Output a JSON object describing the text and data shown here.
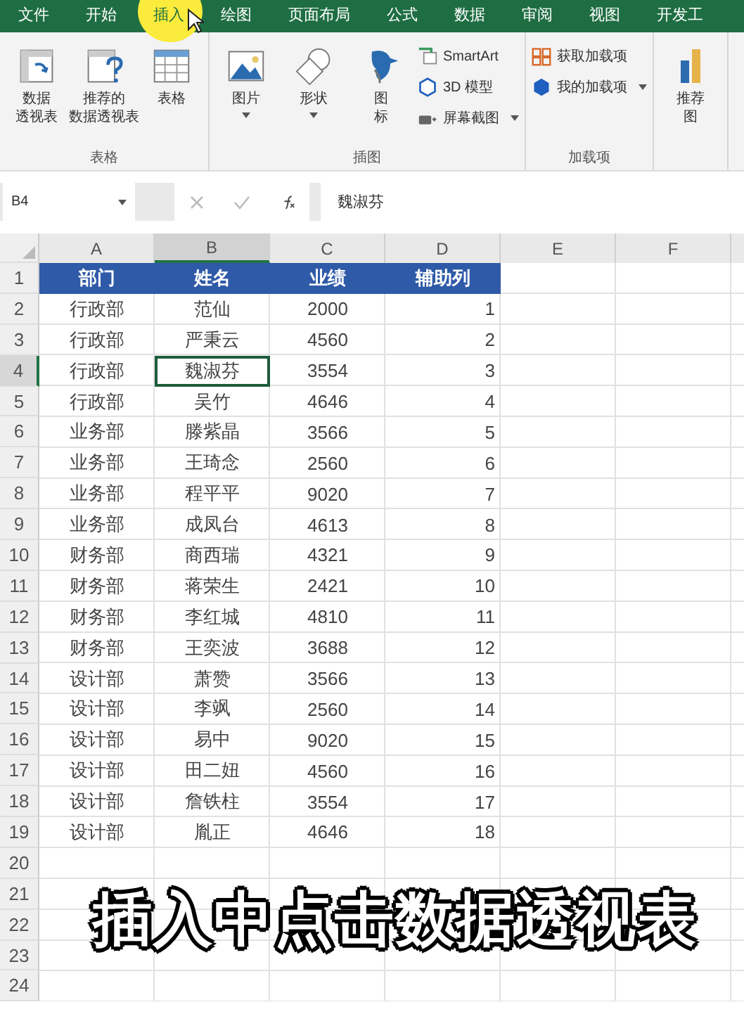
{
  "menu_tabs": [
    {
      "label": "文件",
      "selected": false
    },
    {
      "label": "开始",
      "selected": false
    },
    {
      "label": "插入",
      "selected": true
    },
    {
      "label": "绘图",
      "selected": false
    },
    {
      "label": "页面布局",
      "selected": false
    },
    {
      "label": "公式",
      "selected": false
    },
    {
      "label": "数据",
      "selected": false
    },
    {
      "label": "审阅",
      "selected": false
    },
    {
      "label": "视图",
      "selected": false
    },
    {
      "label": "开发工",
      "selected": false
    }
  ],
  "ribbon_groups": [
    {
      "label": "表格",
      "items": [
        {
          "kind": "large",
          "lines": [
            "数据",
            "透视表"
          ]
        },
        {
          "kind": "large",
          "lines": [
            "推荐的",
            "数据透视表"
          ]
        },
        {
          "kind": "large",
          "lines": [
            "表格"
          ]
        }
      ]
    },
    {
      "label": "插图",
      "items": [
        {
          "kind": "large",
          "lines": [
            "图片"
          ],
          "dropdown": true
        },
        {
          "kind": "large",
          "lines": [
            "形状"
          ],
          "dropdown": true
        },
        {
          "kind": "large",
          "lines": [
            "图",
            "标"
          ]
        },
        {
          "kind": "stack",
          "entries": [
            {
              "label": "SmartArt"
            },
            {
              "label": "3D 模型"
            },
            {
              "label": "屏幕截图",
              "dropdown": true
            }
          ]
        }
      ]
    },
    {
      "label": "加载项",
      "items": [
        {
          "kind": "stack",
          "entries": [
            {
              "label": "获取加载项"
            },
            {
              "label": "我的加载项",
              "dropdown": true
            }
          ]
        }
      ]
    },
    {
      "items": [
        {
          "kind": "large",
          "lines": [
            "推荐",
            "图"
          ]
        }
      ]
    }
  ],
  "formula_bar": {
    "name_box": "B4",
    "value": "魏淑芬"
  },
  "columns": [
    {
      "label": "A",
      "selected": false
    },
    {
      "label": "B",
      "selected": true
    },
    {
      "label": "C",
      "selected": false
    },
    {
      "label": "D",
      "selected": false
    },
    {
      "label": "E",
      "selected": false
    },
    {
      "label": "F",
      "selected": false
    }
  ],
  "rows": [
    {
      "number": "1",
      "kind": "header",
      "selected": false,
      "cells": [
        "部门",
        "姓名",
        "业绩",
        "辅助列"
      ]
    },
    {
      "number": "2",
      "kind": "data",
      "selected": false,
      "cells": [
        "行政部",
        "范仙",
        "2000",
        "1"
      ]
    },
    {
      "number": "3",
      "kind": "data",
      "selected": false,
      "cells": [
        "行政部",
        "严秉云",
        "4560",
        "2"
      ]
    },
    {
      "number": "4",
      "kind": "data",
      "selected": true,
      "cells": [
        "行政部",
        "魏淑芬",
        "3554",
        "3"
      ]
    },
    {
      "number": "5",
      "kind": "data",
      "selected": false,
      "cells": [
        "行政部",
        "吴竹",
        "4646",
        "4"
      ]
    },
    {
      "number": "6",
      "kind": "data",
      "selected": false,
      "cells": [
        "业务部",
        "滕紫晶",
        "3566",
        "5"
      ]
    },
    {
      "number": "7",
      "kind": "data",
      "selected": false,
      "cells": [
        "业务部",
        "王琦念",
        "2560",
        "6"
      ]
    },
    {
      "number": "8",
      "kind": "data",
      "selected": false,
      "cells": [
        "业务部",
        "程平平",
        "9020",
        "7"
      ]
    },
    {
      "number": "9",
      "kind": "data",
      "selected": false,
      "cells": [
        "业务部",
        "成凤台",
        "4613",
        "8"
      ]
    },
    {
      "number": "10",
      "kind": "data",
      "selected": false,
      "cells": [
        "财务部",
        "商西瑞",
        "4321",
        "9"
      ]
    },
    {
      "number": "11",
      "kind": "data",
      "selected": false,
      "cells": [
        "财务部",
        "蒋荣生",
        "2421",
        "10"
      ]
    },
    {
      "number": "12",
      "kind": "data",
      "selected": false,
      "cells": [
        "财务部",
        "李红城",
        "4810",
        "11"
      ]
    },
    {
      "number": "13",
      "kind": "data",
      "selected": false,
      "cells": [
        "财务部",
        "王奕波",
        "3688",
        "12"
      ]
    },
    {
      "number": "14",
      "kind": "data",
      "selected": false,
      "cells": [
        "设计部",
        "萧赞",
        "3566",
        "13"
      ]
    },
    {
      "number": "15",
      "kind": "data",
      "selected": false,
      "cells": [
        "设计部",
        "李飒",
        "2560",
        "14"
      ]
    },
    {
      "number": "16",
      "kind": "data",
      "selected": false,
      "cells": [
        "设计部",
        "易中",
        "9020",
        "15"
      ]
    },
    {
      "number": "17",
      "kind": "data",
      "selected": false,
      "cells": [
        "设计部",
        "田二妞",
        "4560",
        "16"
      ]
    },
    {
      "number": "18",
      "kind": "data",
      "selected": false,
      "cells": [
        "设计部",
        "詹铁柱",
        "3554",
        "17"
      ]
    },
    {
      "number": "19",
      "kind": "data",
      "selected": false,
      "cells": [
        "设计部",
        "胤正",
        "4646",
        "18"
      ]
    },
    {
      "number": "20",
      "selected": false
    },
    {
      "number": "21",
      "selected": false
    },
    {
      "number": "22",
      "selected": false
    },
    {
      "number": "23",
      "selected": false
    },
    {
      "number": "24",
      "selected": false
    }
  ],
  "caption": "插入中点击数据透视表"
}
